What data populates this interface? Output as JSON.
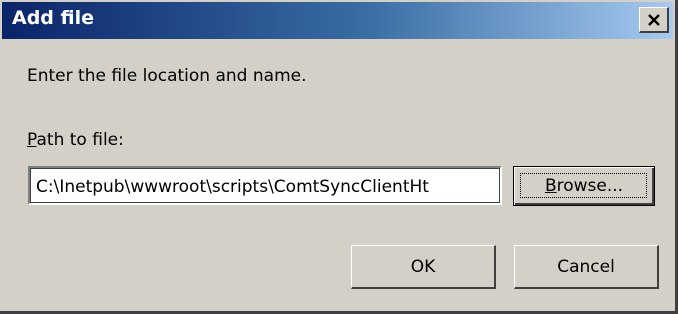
{
  "window": {
    "title": "Add file",
    "close_icon": "close-icon"
  },
  "body": {
    "prompt": "Enter the file location and name.",
    "path_label_accel": "P",
    "path_label_rest": "ath to file:"
  },
  "path_field": {
    "value": "C:\\Inetpub\\wwwroot\\scripts\\ComtSyncClientHt"
  },
  "buttons": {
    "browse_accel": "B",
    "browse_rest": "rowse...",
    "ok": "OK",
    "cancel": "Cancel"
  },
  "colors": {
    "face": "#d4d0c8",
    "title_gradient_start": "#0a246a",
    "title_gradient_end": "#a6caf0"
  }
}
